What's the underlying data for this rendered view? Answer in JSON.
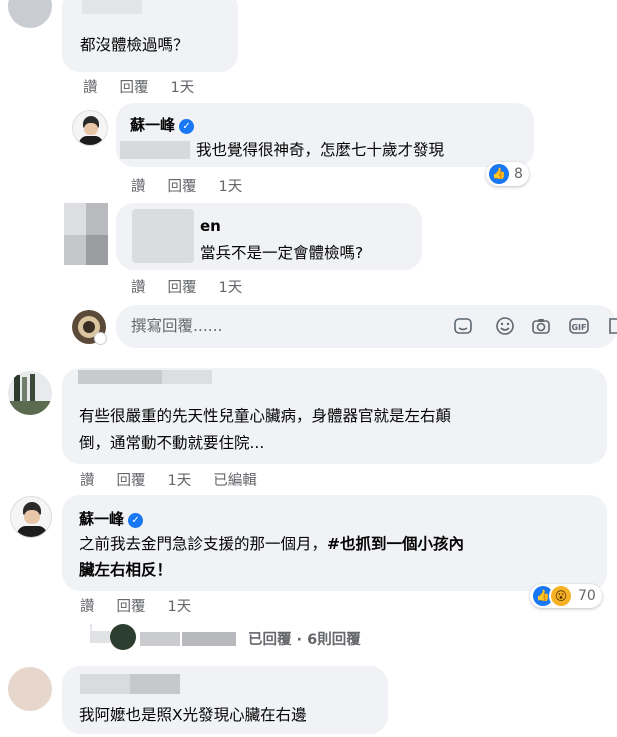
{
  "comments": [
    {
      "text": "都沒體檢過嗎？",
      "actions": {
        "like": "讚",
        "reply": "回覆",
        "time": "1天"
      }
    },
    {
      "author": "蘇一峰",
      "text": "我也覺得很神奇，怎麼七十歲才發現",
      "reactions": "8",
      "actions": {
        "like": "讚",
        "reply": "回覆",
        "time": "1天"
      }
    },
    {
      "author": "en",
      "text": "當兵不是一定會體檢嗎?",
      "actions": {
        "like": "讚",
        "reply": "回覆",
        "time": "1天"
      }
    },
    {
      "text_line1": "有些很嚴重的先天性兒童心臟病，身體器官就是左右顛",
      "text_line2": "倒，通常動不動就要住院...",
      "actions": {
        "like": "讚",
        "reply": "回覆",
        "time": "1天",
        "edited": "已編輯"
      }
    },
    {
      "author": "蘇一峰",
      "text_line1": "之前我去金門急診支援的那一個月，",
      "text_line1_bold": "#也抓到一個小孩內",
      "text_line2": "臟左右相反！",
      "reactions": "70",
      "actions": {
        "like": "讚",
        "reply": "回覆",
        "time": "1天"
      },
      "replies_summary": "已回覆 · 6則回覆"
    },
    {
      "text": "我阿嬤也是照X光發現心臟在右邊"
    }
  ],
  "reply_box": {
    "placeholder": "撰寫回覆......"
  },
  "icons": [
    "verified-badge-icon",
    "like-reaction-icon",
    "wow-reaction-icon",
    "sticker-icon",
    "emoji-icon",
    "camera-icon",
    "gif-icon",
    "sticker-alt-icon"
  ],
  "colors": {
    "bubble": "#f0f2f5",
    "verified": "#1877f2",
    "meta": "#65676b"
  }
}
